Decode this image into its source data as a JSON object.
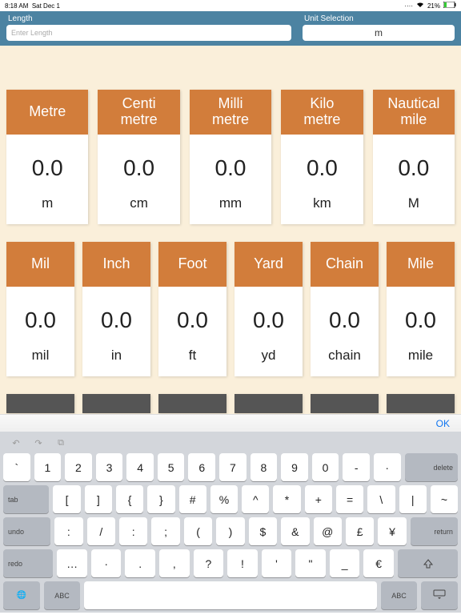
{
  "status": {
    "time": "8:18 AM",
    "date": "Sat Dec 1",
    "battery": "21%"
  },
  "header": {
    "length_label": "Length",
    "length_placeholder": "Enter Length",
    "unit_label": "Unit Selection",
    "unit_value": "m"
  },
  "row1": [
    {
      "name": "Metre",
      "val": "0.0",
      "sym": "m"
    },
    {
      "name": "Centi\nmetre",
      "val": "0.0",
      "sym": "cm"
    },
    {
      "name": "Milli\nmetre",
      "val": "0.0",
      "sym": "mm"
    },
    {
      "name": "Kilo\nmetre",
      "val": "0.0",
      "sym": "km"
    },
    {
      "name": "Nautical\nmile",
      "val": "0.0",
      "sym": "M"
    }
  ],
  "row2": [
    {
      "name": "Mil",
      "val": "0.0",
      "sym": "mil"
    },
    {
      "name": "Inch",
      "val": "0.0",
      "sym": "in"
    },
    {
      "name": "Foot",
      "val": "0.0",
      "sym": "ft"
    },
    {
      "name": "Yard",
      "val": "0.0",
      "sym": "yd"
    },
    {
      "name": "Chain",
      "val": "0.0",
      "sym": "chain"
    },
    {
      "name": "Mile",
      "val": "0.0",
      "sym": "mile"
    }
  ],
  "ok": "OK",
  "kb": {
    "r1": [
      "`",
      "1",
      "2",
      "3",
      "4",
      "5",
      "6",
      "7",
      "8",
      "9",
      "0",
      "-",
      "·"
    ],
    "del": "delete",
    "tab": "tab",
    "r2": [
      "[",
      "]",
      "{",
      "}",
      "#",
      "%",
      "^",
      "*",
      "+",
      "=",
      "\\",
      "|",
      "~"
    ],
    "undo": "undo",
    "r3": [
      ":",
      "/",
      ":",
      ";",
      "(",
      ")",
      "$",
      "&",
      "@",
      "£",
      "¥"
    ],
    "return": "return",
    "redo": "redo",
    "r4": [
      "…",
      "·",
      ".",
      ",",
      "?",
      "!",
      "'",
      "\"",
      "_",
      "€"
    ],
    "abc": "ABC"
  }
}
